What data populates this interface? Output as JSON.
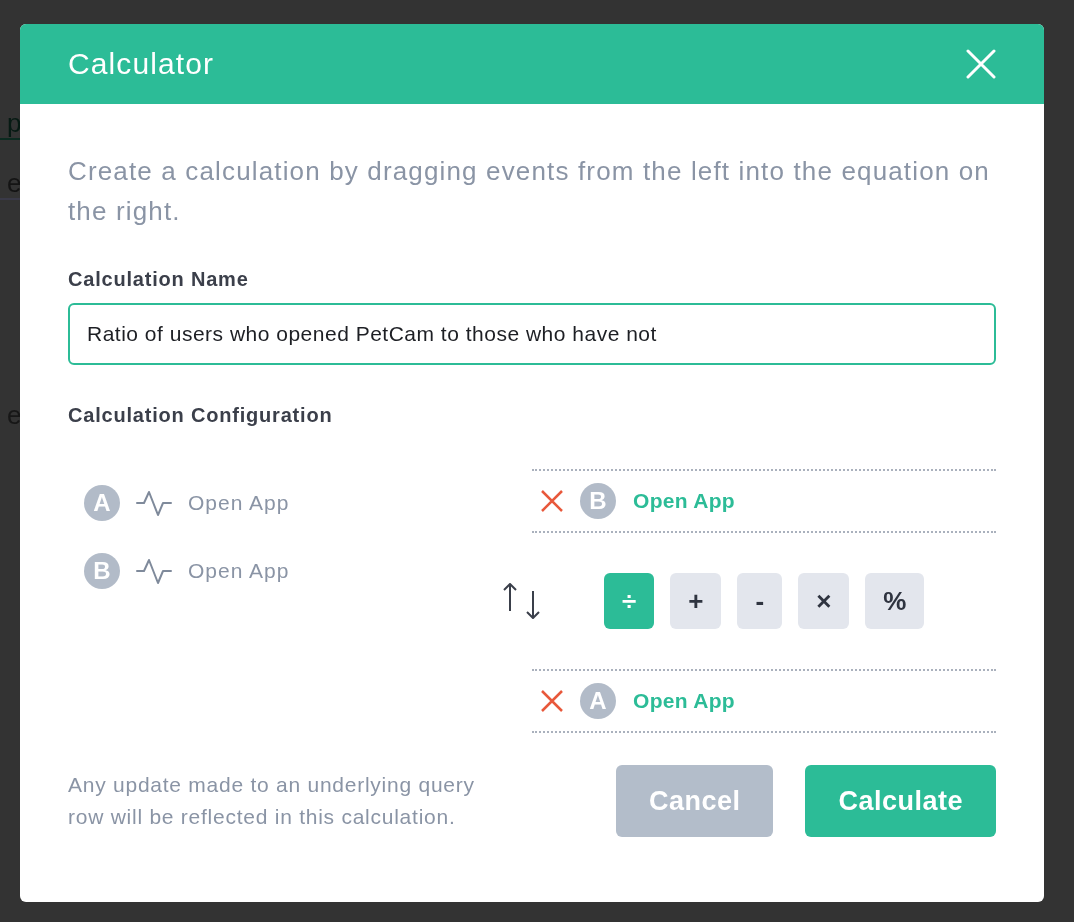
{
  "background": {
    "texts": [
      "p",
      "e",
      "e"
    ]
  },
  "dialog": {
    "title": "Calculator"
  },
  "description": "Create a calculation by dragging events from the left into the equation on the right.",
  "name_field": {
    "label": "Calculation Name",
    "value": "Ratio of users who opened PetCam to those who have not"
  },
  "configuration": {
    "label": "Calculation Configuration",
    "events": [
      {
        "badge": "A",
        "name": "Open App"
      },
      {
        "badge": "B",
        "name": "Open App"
      }
    ],
    "numerator": {
      "badge": "B",
      "name": "Open App"
    },
    "operators": [
      {
        "symbol": "÷",
        "selected": true
      },
      {
        "symbol": "+",
        "selected": false
      },
      {
        "symbol": "-",
        "selected": false
      },
      {
        "symbol": "×",
        "selected": false
      },
      {
        "symbol": "%",
        "selected": false
      }
    ],
    "denominator": {
      "badge": "A",
      "name": "Open App"
    }
  },
  "note": "Any update made to an underlying query row will be reflected in this calculation.",
  "buttons": [
    {
      "label": "Cancel",
      "kind": "secondary"
    },
    {
      "label": "Calculate",
      "kind": "primary"
    }
  ]
}
